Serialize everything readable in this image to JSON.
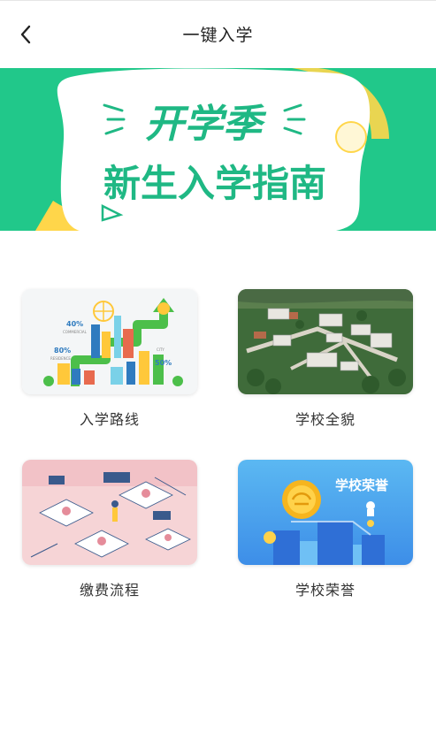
{
  "header": {
    "title": "一键入学",
    "back_icon": "chevron-left-icon"
  },
  "banner": {
    "line1": "开学季",
    "line2": "新生入学指南",
    "colors": {
      "green": "#21c88a",
      "yellow": "#ffd64a",
      "text": "#1fb884"
    }
  },
  "items": [
    {
      "label": "入学路线",
      "badges": [
        "40%",
        "COMMERCIAL",
        "80%",
        "RESIDENCE",
        "50%",
        "CITY"
      ]
    },
    {
      "label": "学校全貌"
    },
    {
      "label": "缴费流程"
    },
    {
      "label": "学校荣誉",
      "badge": "学校荣誉"
    }
  ]
}
